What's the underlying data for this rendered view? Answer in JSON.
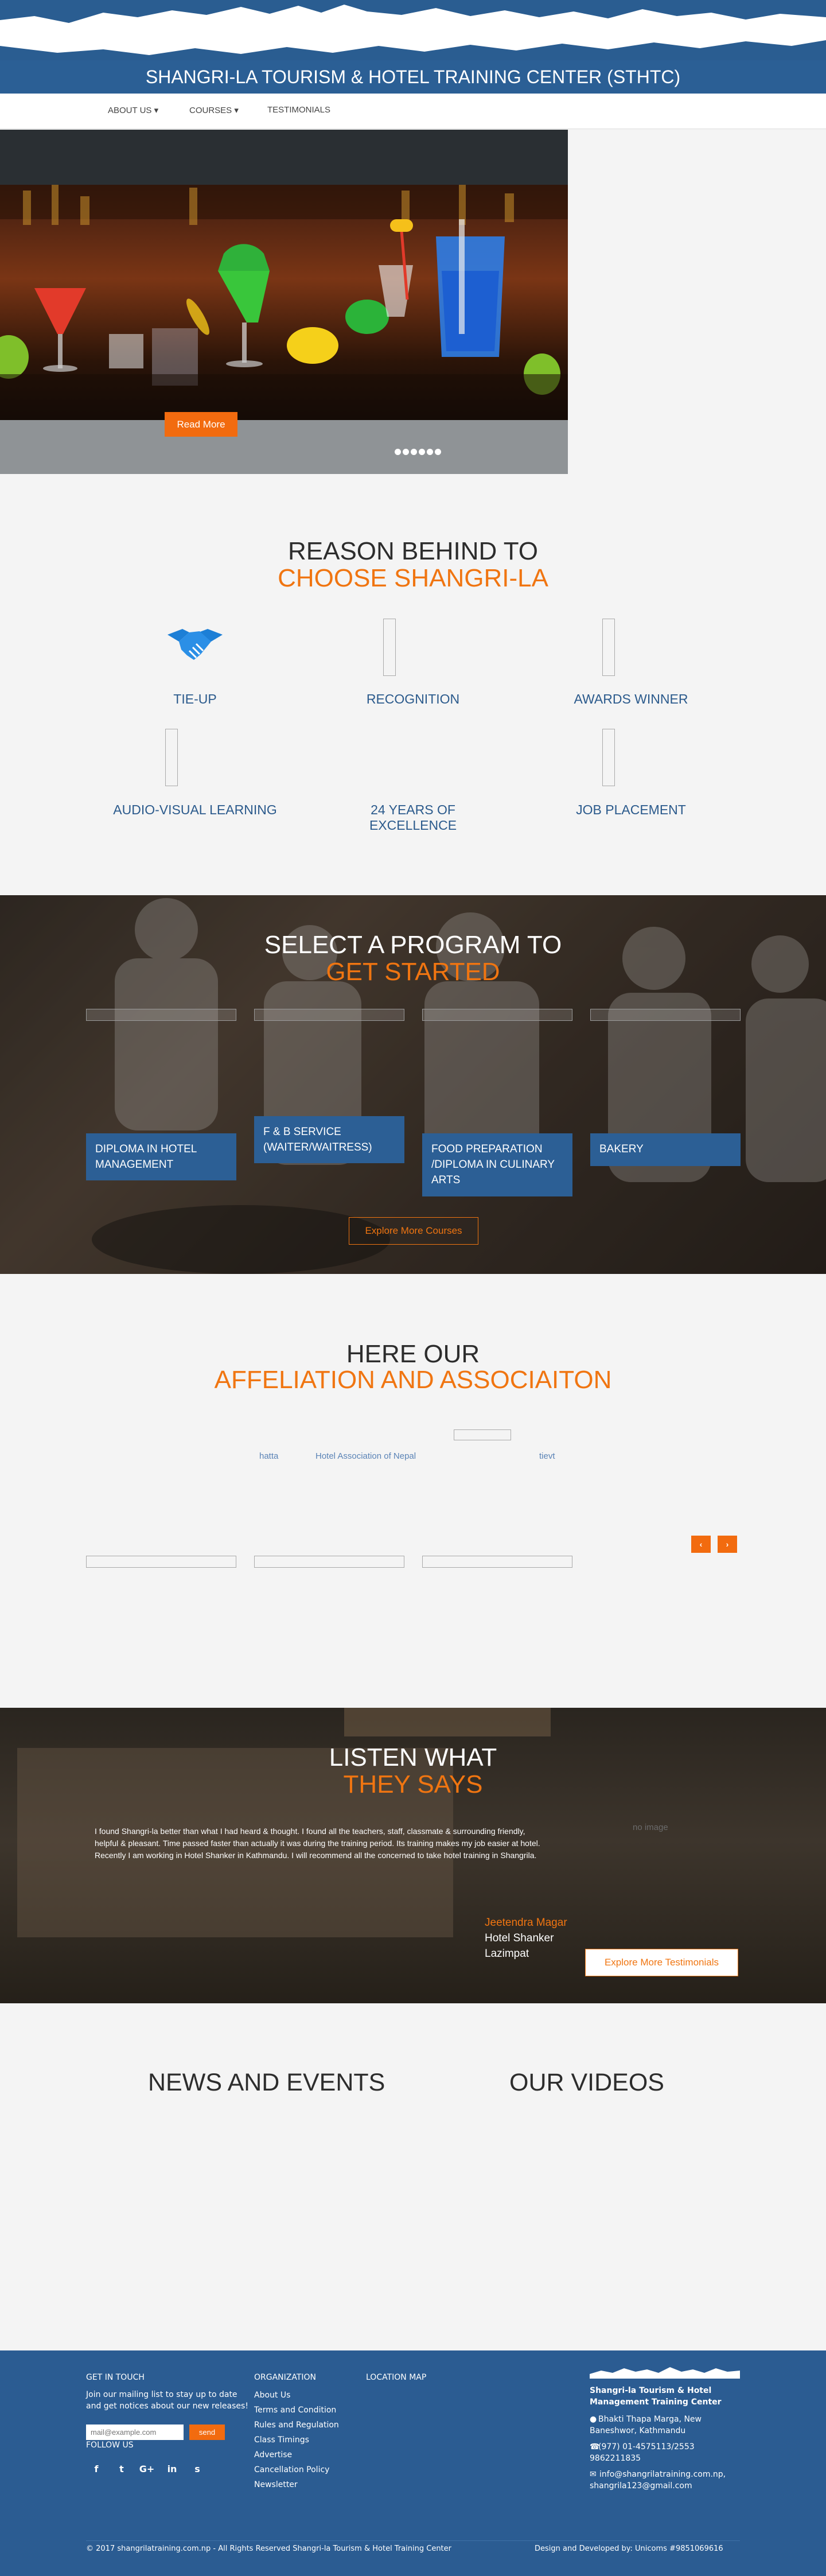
{
  "header": {
    "title": "SHANGRI-LA TOURISM & HOTEL TRAINING CENTER (STHTC)",
    "nav": [
      {
        "label": "ABOUT US ▾"
      },
      {
        "label": "COURSES ▾"
      },
      {
        "label": "TESTIMONIALS"
      }
    ]
  },
  "slider": {
    "button_label": "Read More"
  },
  "reasons": {
    "heading_line1": "REASON BEHIND TO",
    "heading_line2": "CHOOSE SHANGRI-LA",
    "items": [
      {
        "label": "TIE-UP",
        "icon": "handshake-icon"
      },
      {
        "label": "RECOGNITION"
      },
      {
        "label": "AWARDS WINNER"
      },
      {
        "label": "AUDIO-VISUAL LEARNING"
      },
      {
        "label": "24 YEARS OF EXCELLENCE"
      },
      {
        "label": "JOB PLACEMENT"
      }
    ]
  },
  "programs": {
    "heading_line1": "SELECT A PROGRAM TO",
    "heading_line2": "GET STARTED",
    "items": [
      {
        "line1": "DIPLOMA IN HOTEL",
        "line2": "MANAGEMENT",
        "line3": ""
      },
      {
        "line1": "F & B SERVICE",
        "line2": "(WAITER/WAITRESS)",
        "line3": ""
      },
      {
        "line1": "FOOD PREPARATION",
        "line2": "/DIPLOMA IN CULINARY",
        "line3": "ARTS"
      },
      {
        "line1": "BAKERY",
        "line2": "",
        "line3": ""
      }
    ],
    "button_label": "Explore More Courses"
  },
  "affiliation": {
    "heading_line1": "HERE OUR",
    "heading_line2": "AFFELIATION AND ASSOCIAITON",
    "logo_alts": [
      "hatta",
      "Hotel Association of Nepal",
      "tievt"
    ],
    "prev_label": "‹",
    "next_label": "›"
  },
  "testimonials": {
    "heading_line1": "LISTEN WHAT",
    "heading_line2": "THEY SAYS",
    "quote_line1": "I found Shangri-la better than what I had heard & thought. I found all the teachers, staff, classmate & surrounding friendly,",
    "quote_line2": "helpful & pleasant. Time passed faster than actually it was during the training period. Its training makes my job easier at hotel.",
    "quote_line3": "Recently I am working in Hotel Shanker in Kathmandu. I will recommend all the concerned to take hotel training in Shangrila.",
    "image_alt": "no image",
    "name": "Jeetendra Magar",
    "company": "Hotel Shanker",
    "location": "Lazimpat",
    "button_label": "Explore More Testimonials"
  },
  "news": {
    "news_heading": "NEWS AND EVENTS",
    "videos_heading": "OUR VIDEOS"
  },
  "footer": {
    "get_in_touch": "GET IN TOUCH",
    "mailing_line1": "Join our mailing list to stay up to date",
    "mailing_line2": "and get notices about our new releases!",
    "email_placeholder": "mail@example.com",
    "send_label": "send",
    "follow_us": "FOLLOW US",
    "socials": [
      "f",
      "t",
      "G+",
      "in",
      "s"
    ],
    "organization_heading": "ORGANIZATION",
    "org_links": [
      "About Us",
      "Terms and Condition",
      "Rules and Regulation",
      "Class Timings",
      "Advertise",
      "Cancellation Policy",
      "Newsletter"
    ],
    "location_heading": "LOCATION MAP",
    "org_name_line1": "Shangri-la Tourism & Hotel",
    "org_name_line2": "Management Training Center",
    "address_line1": "Bhakti Thapa Marga, New",
    "address_line2": "Baneshwor, Kathmandu",
    "phone_line1": "(977) 01-4575113/2553",
    "phone_line2": "9862211835",
    "email_line1": "info@shangrilatraining.com.np,",
    "email_line2": "shangrila123@gmail.com",
    "copyright": "© 2017 shangrilatraining.com.np - All Rights Reserved Shangri-la Tourism & Hotel Training Center",
    "credits": "Design and Developed by: Unicoms #9851069616"
  },
  "colors": {
    "brand_blue": "#2b5f95",
    "accent_orange": "#f07511",
    "button_orange": "#f26b0f"
  }
}
